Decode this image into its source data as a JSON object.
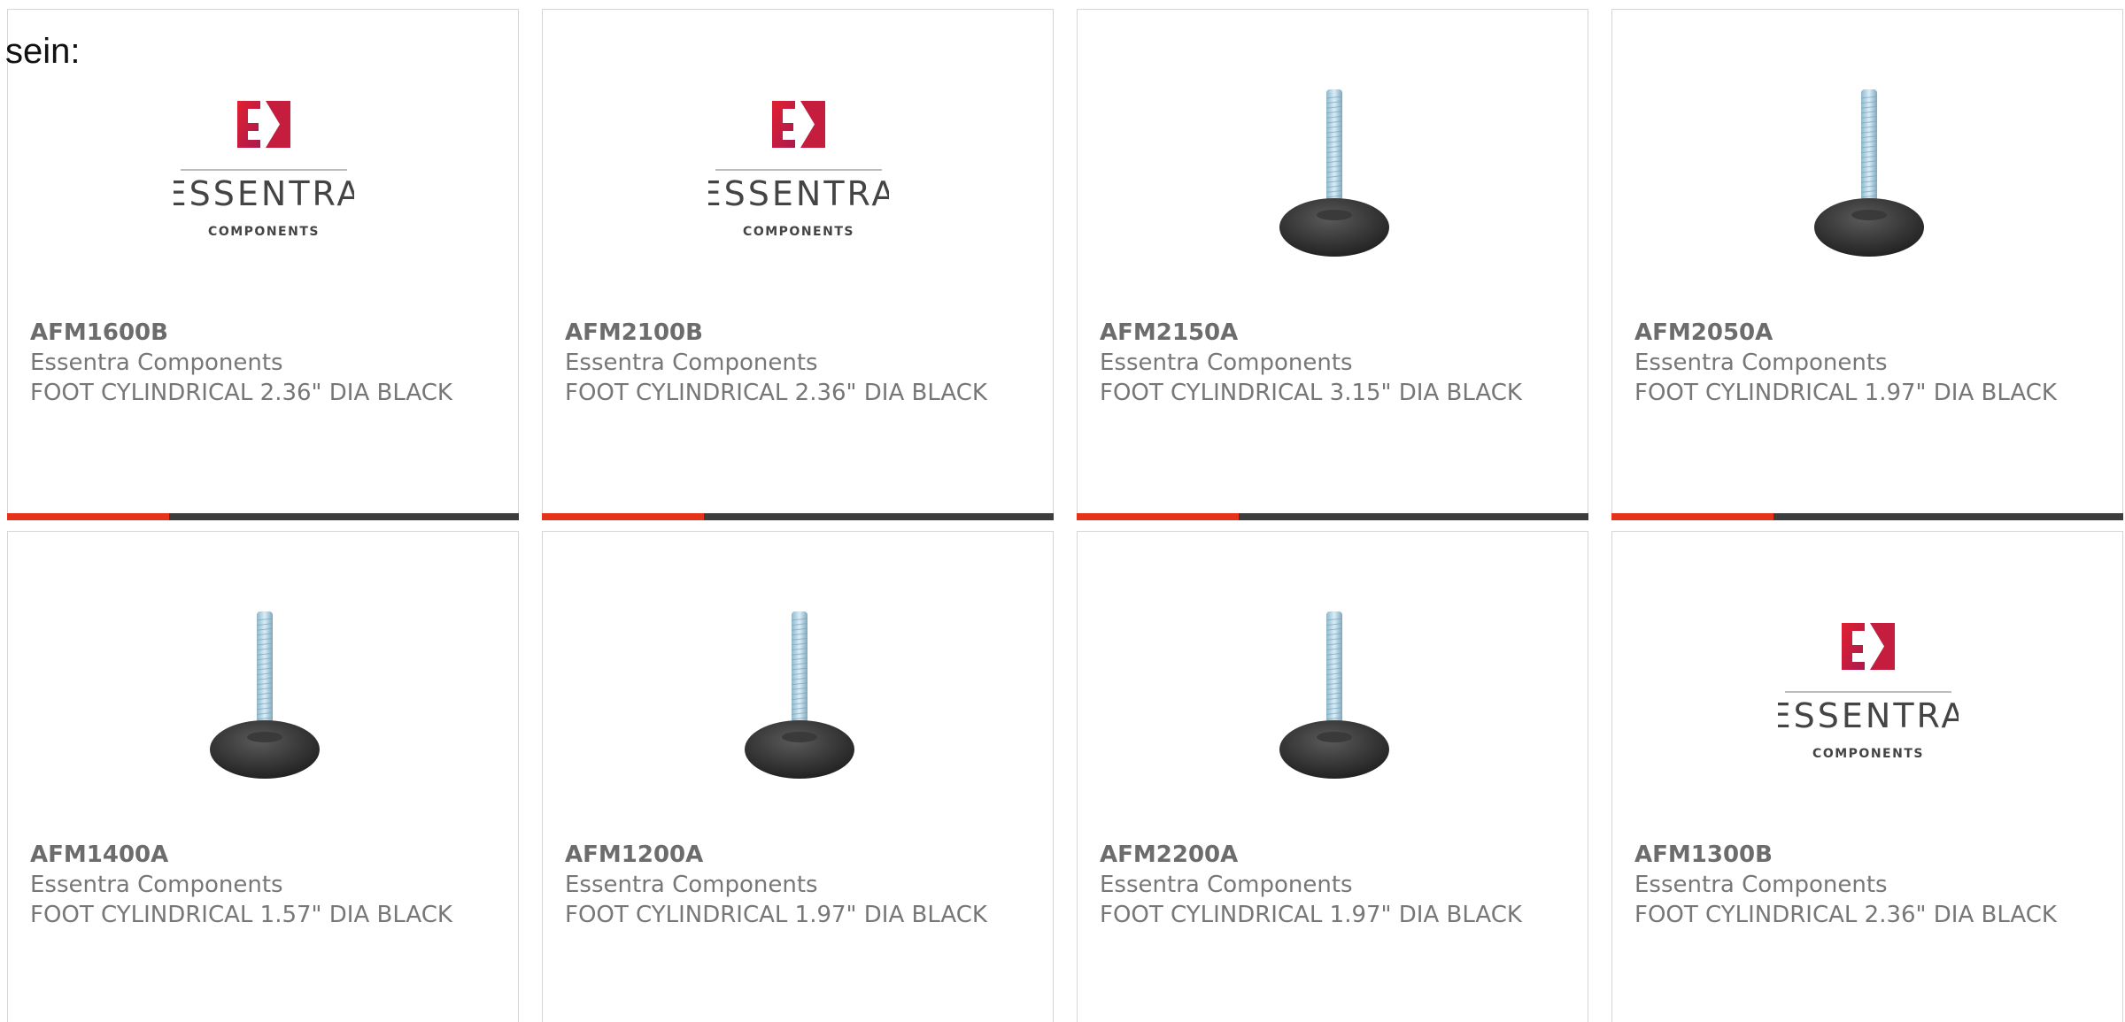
{
  "intro": "sein:",
  "colors": {
    "accent": "#e5321b",
    "bar": "#3c3c3c",
    "text": "#777777",
    "border": "#d6d6d6"
  },
  "products": [
    {
      "part_number": "AFM1600B",
      "manufacturer": "Essentra Components",
      "description": "FOOT CYLINDRICAL 2.36\" DIA BLACK",
      "image": "essentra-logo"
    },
    {
      "part_number": "AFM2100B",
      "manufacturer": "Essentra Components",
      "description": "FOOT CYLINDRICAL 2.36\" DIA BLACK",
      "image": "essentra-logo"
    },
    {
      "part_number": "AFM2150A",
      "manufacturer": "Essentra Components",
      "description": "FOOT CYLINDRICAL 3.15\" DIA BLACK",
      "image": "leveling-foot"
    },
    {
      "part_number": "AFM2050A",
      "manufacturer": "Essentra Components",
      "description": "FOOT CYLINDRICAL 1.97\" DIA BLACK",
      "image": "leveling-foot"
    },
    {
      "part_number": "AFM1400A",
      "manufacturer": "Essentra Components",
      "description": "FOOT CYLINDRICAL 1.57\" DIA BLACK",
      "image": "leveling-foot"
    },
    {
      "part_number": "AFM1200A",
      "manufacturer": "Essentra Components",
      "description": "FOOT CYLINDRICAL 1.97\" DIA BLACK",
      "image": "leveling-foot"
    },
    {
      "part_number": "AFM2200A",
      "manufacturer": "Essentra Components",
      "description": "FOOT CYLINDRICAL 1.97\" DIA BLACK",
      "image": "leveling-foot"
    },
    {
      "part_number": "AFM1300B",
      "manufacturer": "Essentra Components",
      "description": "FOOT CYLINDRICAL 2.36\" DIA BLACK",
      "image": "essentra-logo"
    }
  ],
  "logo": {
    "wordmark": "ESSENTRA",
    "tagline": "COMPONENTS",
    "letter": "E"
  }
}
